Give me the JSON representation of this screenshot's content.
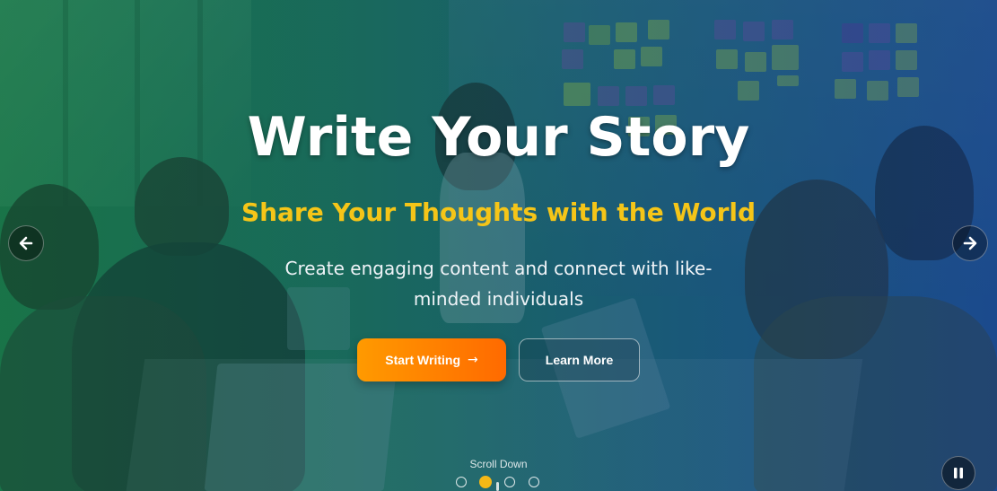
{
  "hero": {
    "title": "Write Your Story",
    "subtitle": "Share Your Thoughts with the World",
    "description": "Create engaging content and connect with like-minded individuals",
    "primary_button": "Start Writing",
    "primary_button_icon": "→",
    "secondary_button": "Learn More",
    "scroll_label": "Scroll Down"
  },
  "carousel": {
    "prev_icon": "arrow-left-icon",
    "next_icon": "arrow-right-icon",
    "pause_icon": "pause-icon",
    "slide_count": 4,
    "active_slide": 2
  },
  "colors": {
    "title": "#ffffff",
    "subtitle": "#f5c518",
    "primary_start": "#ff9a00",
    "primary_end": "#ff6a00",
    "active_dot": "#f5b816",
    "overlay_left": "#1f7a4a",
    "overlay_right": "#1e4f8f"
  }
}
